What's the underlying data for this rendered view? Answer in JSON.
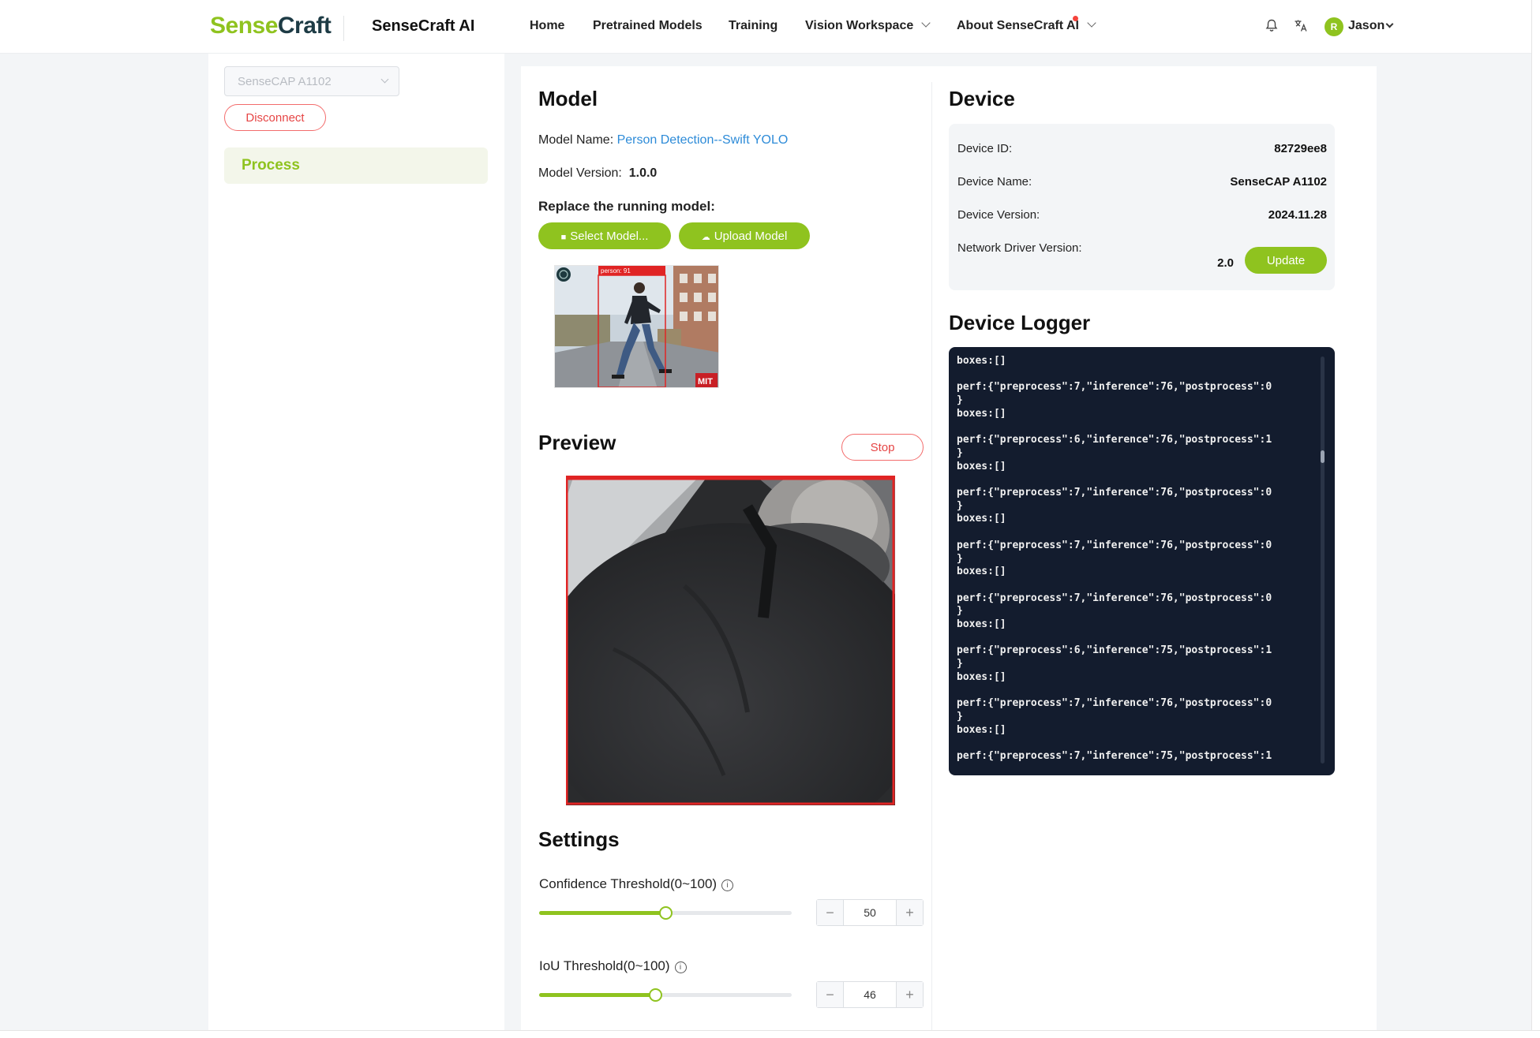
{
  "header": {
    "logo_part1": "Sense",
    "logo_part2": "Craft",
    "app_name": "SenseCraft AI",
    "nav": {
      "home": "Home",
      "pretrained": "Pretrained Models",
      "training": "Training",
      "vision": "Vision Workspace",
      "about": "About SenseCraft AI"
    },
    "user": {
      "initial": "R",
      "name": "Jason"
    }
  },
  "sidebar": {
    "device_select_value": "SenseCAP A1102",
    "disconnect_label": "Disconnect",
    "process_label": "Process"
  },
  "model": {
    "title": "Model",
    "name_label": "Model Name:",
    "name_value": "Person Detection--Swift YOLO",
    "version_label": "Model Version:",
    "version_value": "1.0.0",
    "replace_label": "Replace the running model:",
    "select_btn": "Select Model...",
    "upload_btn": "Upload Model",
    "thumb_label": "person: 91",
    "thumb_badge": "MIT"
  },
  "preview": {
    "title": "Preview",
    "stop_btn": "Stop"
  },
  "settings": {
    "title": "Settings",
    "confidence": {
      "label": "Confidence Threshold(0~100)",
      "value": "50",
      "percent": 50
    },
    "iou": {
      "label": "IoU Threshold(0~100)",
      "value": "46",
      "percent": 46
    }
  },
  "device": {
    "title": "Device",
    "id_label": "Device ID:",
    "id_value": "82729ee8",
    "name_label": "Device Name:",
    "name_value": "SenseCAP A1102",
    "version_label": "Device Version:",
    "version_value": "2024.11.28",
    "driver_label": "Network Driver Version:",
    "driver_value": "2.0",
    "update_btn": "Update"
  },
  "logger": {
    "title": "Device Logger",
    "text": "boxes:[]\n\nperf:{\"preprocess\":7,\"inference\":76,\"postprocess\":0\n}\nboxes:[]\n\nperf:{\"preprocess\":6,\"inference\":76,\"postprocess\":1\n}\nboxes:[]\n\nperf:{\"preprocess\":7,\"inference\":76,\"postprocess\":0\n}\nboxes:[]\n\nperf:{\"preprocess\":7,\"inference\":76,\"postprocess\":0\n}\nboxes:[]\n\nperf:{\"preprocess\":7,\"inference\":76,\"postprocess\":0\n}\nboxes:[]\n\nperf:{\"preprocess\":6,\"inference\":75,\"postprocess\":1\n}\nboxes:[]\n\nperf:{\"preprocess\":7,\"inference\":76,\"postprocess\":0\n}\nboxes:[]\n\nperf:{\"preprocess\":7,\"inference\":75,\"postprocess\":1"
  },
  "colors": {
    "accent": "#8fc31f",
    "danger": "#e64545",
    "link": "#2d8bd8",
    "logger_bg": "#131c2e"
  }
}
